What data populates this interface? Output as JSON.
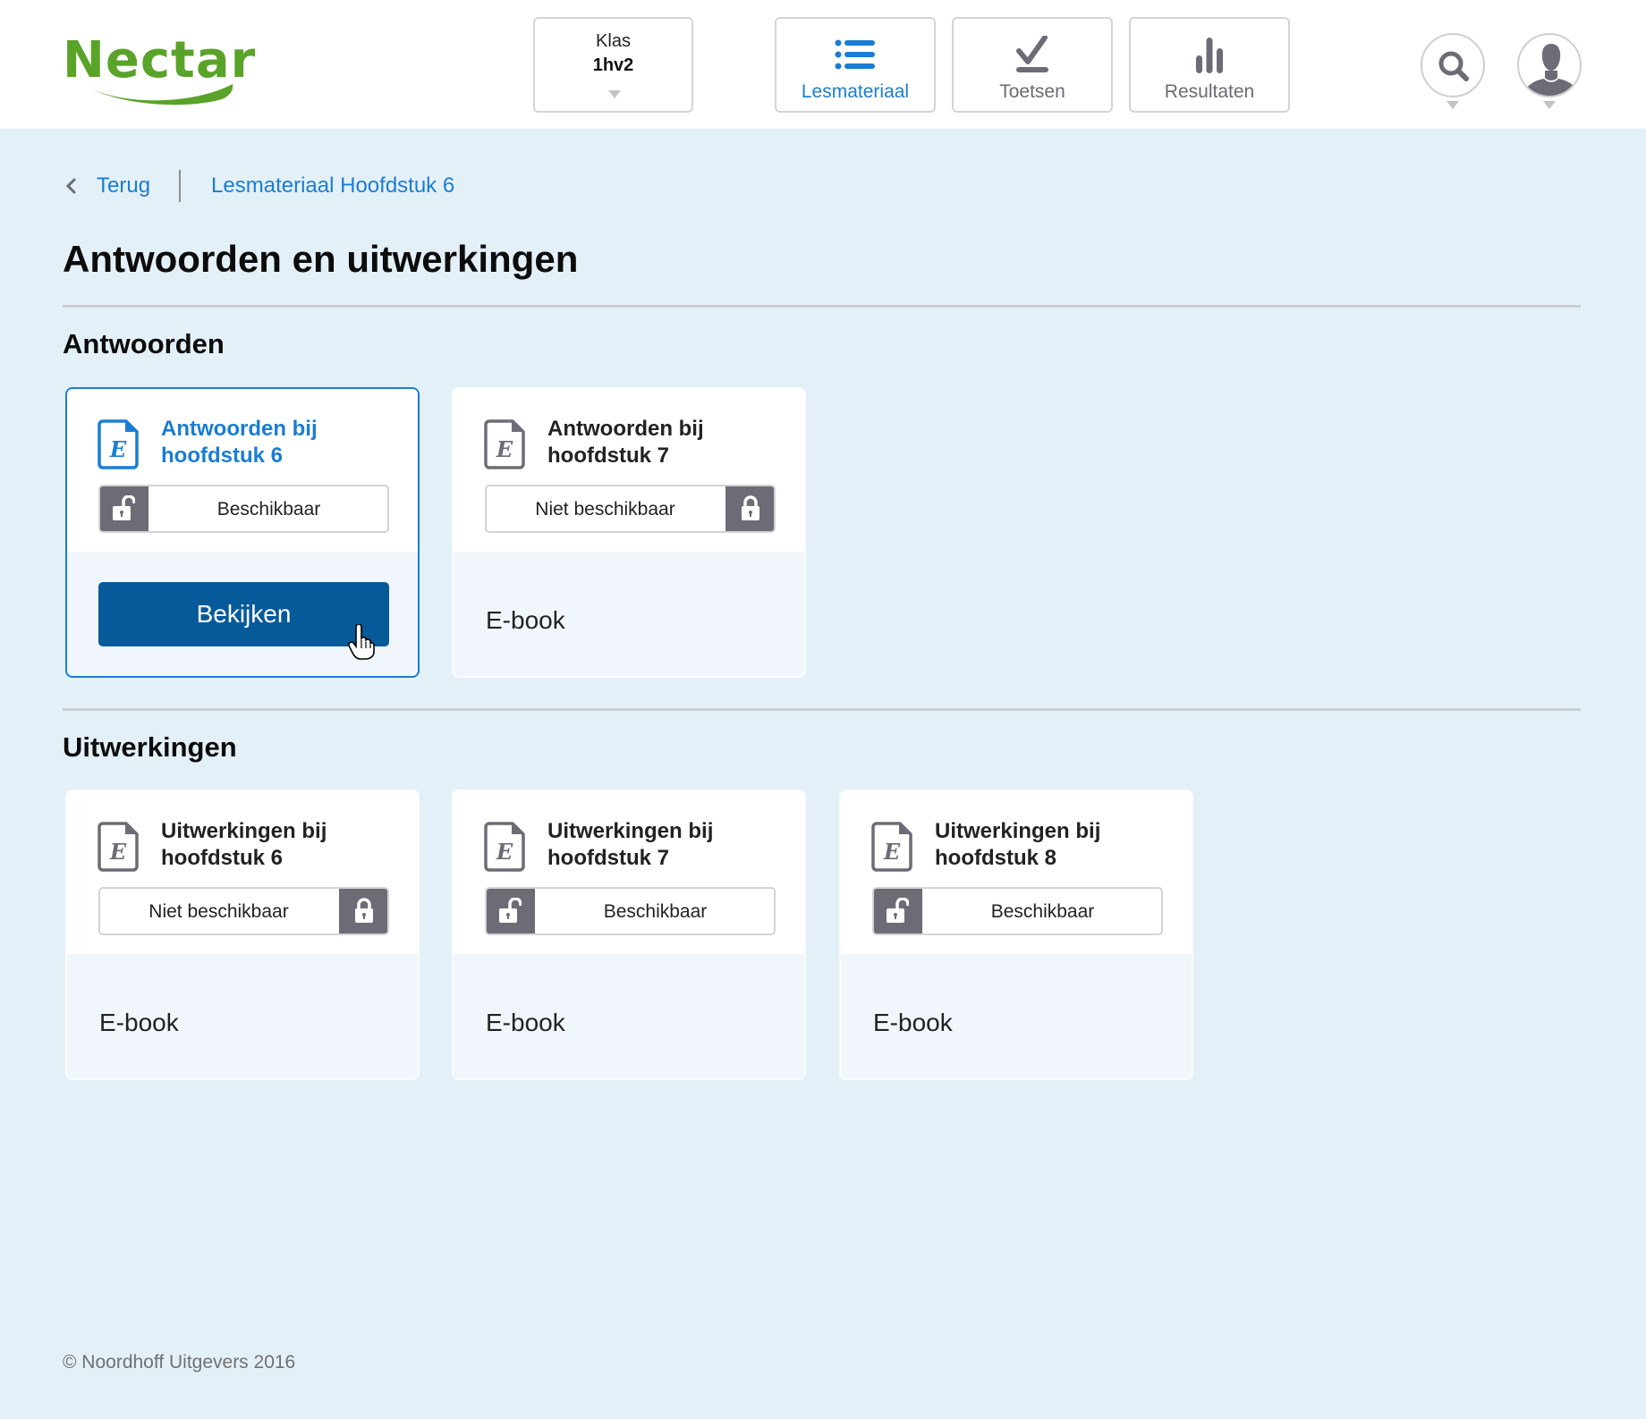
{
  "header": {
    "logo_text": "Nectar",
    "klas": {
      "label": "Klas",
      "value": "1hv2"
    },
    "nav": [
      {
        "label": "Lesmateriaal",
        "icon": "list-icon",
        "active": true
      },
      {
        "label": "Toetsen",
        "icon": "checkmark-icon",
        "active": false
      },
      {
        "label": "Resultaten",
        "icon": "bar-chart-icon",
        "active": false
      }
    ],
    "search_icon": "search-icon",
    "user_icon": "user-avatar-icon"
  },
  "breadcrumb": {
    "back_label": "Terug",
    "current": "Lesmateriaal Hoofdstuk 6"
  },
  "page_title": "Antwoorden en uitwerkingen",
  "sections": [
    {
      "title": "Antwoorden",
      "cards": [
        {
          "title": "Antwoorden bij hoofdstuk 6",
          "title_line1": "Antwoorden bij",
          "title_line2": "hoofdstuk 6",
          "status": "Beschikbaar",
          "available": true,
          "selected": true,
          "action_label": "Bekijken"
        },
        {
          "title": "Antwoorden bij hoofdstuk 7",
          "title_line1": "Antwoorden bij",
          "title_line2": "hoofdstuk 7",
          "status": "Niet beschikbaar",
          "available": false,
          "selected": false,
          "type_label": "E-book"
        }
      ]
    },
    {
      "title": "Uitwerkingen",
      "cards": [
        {
          "title": "Uitwerkingen bij hoofdstuk 6",
          "title_line1": "Uitwerkingen bij",
          "title_line2": "hoofdstuk 6",
          "status": "Niet beschikbaar",
          "available": false,
          "selected": false,
          "type_label": "E-book"
        },
        {
          "title": "Uitwerkingen bij hoofdstuk 7",
          "title_line1": "Uitwerkingen bij",
          "title_line2": "hoofdstuk 7",
          "status": "Beschikbaar",
          "available": true,
          "selected": false,
          "type_label": "E-book"
        },
        {
          "title": "Uitwerkingen bij hoofdstuk 8",
          "title_line1": "Uitwerkingen bij",
          "title_line2": "hoofdstuk 8",
          "status": "Beschikbaar",
          "available": true,
          "selected": false,
          "type_label": "E-book"
        }
      ]
    }
  ],
  "footer": {
    "copyright": "© Noordhoff Uitgevers 2016"
  },
  "colors": {
    "brand_green": "#5aa329",
    "accent_blue": "#1a7dd3",
    "button_blue": "#075a9a",
    "lock_gray": "#6d6c76",
    "page_bg": "#e4f0f8"
  }
}
